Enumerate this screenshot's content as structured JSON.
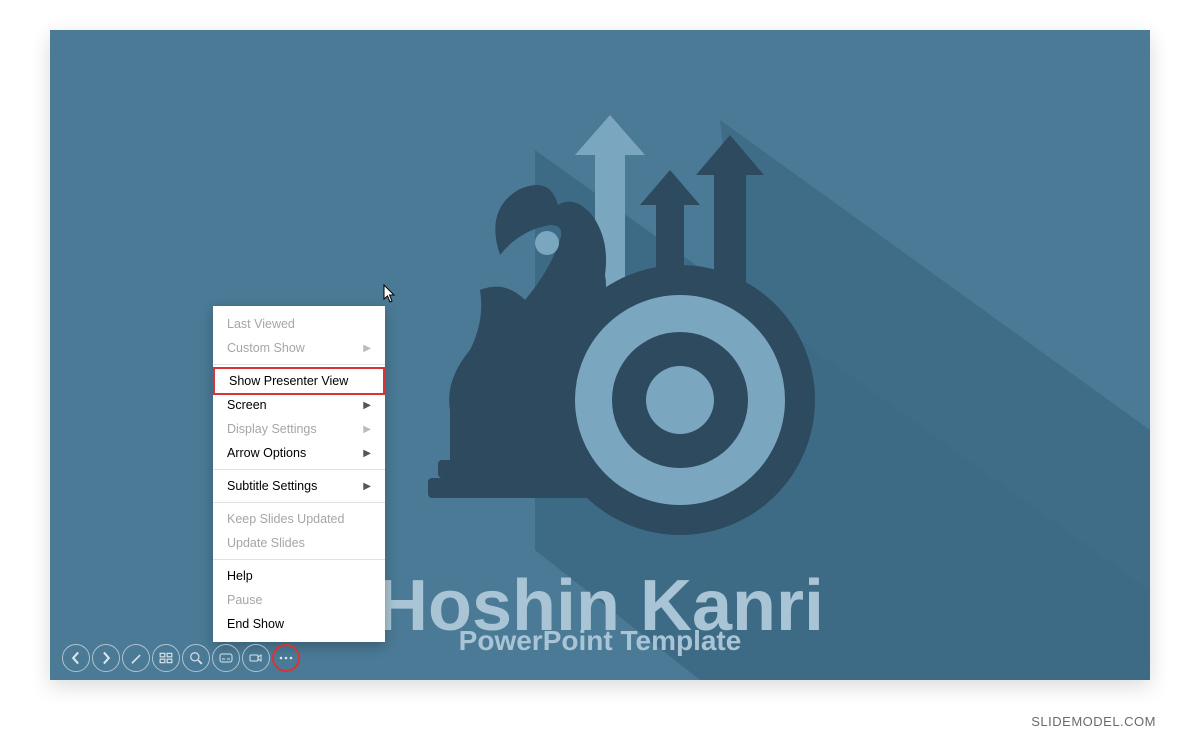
{
  "slide": {
    "title": "Hoshin Kanri",
    "subtitle": "PowerPoint Template"
  },
  "menu": {
    "last_viewed": "Last Viewed",
    "custom_show": "Custom Show",
    "show_presenter_view": "Show Presenter View",
    "screen": "Screen",
    "display_settings": "Display Settings",
    "arrow_options": "Arrow Options",
    "subtitle_settings": "Subtitle Settings",
    "keep_slides_updated": "Keep Slides Updated",
    "update_slides": "Update Slides",
    "help": "Help",
    "pause": "Pause",
    "end_show": "End Show"
  },
  "watermark": "SLIDEMODEL.COM"
}
